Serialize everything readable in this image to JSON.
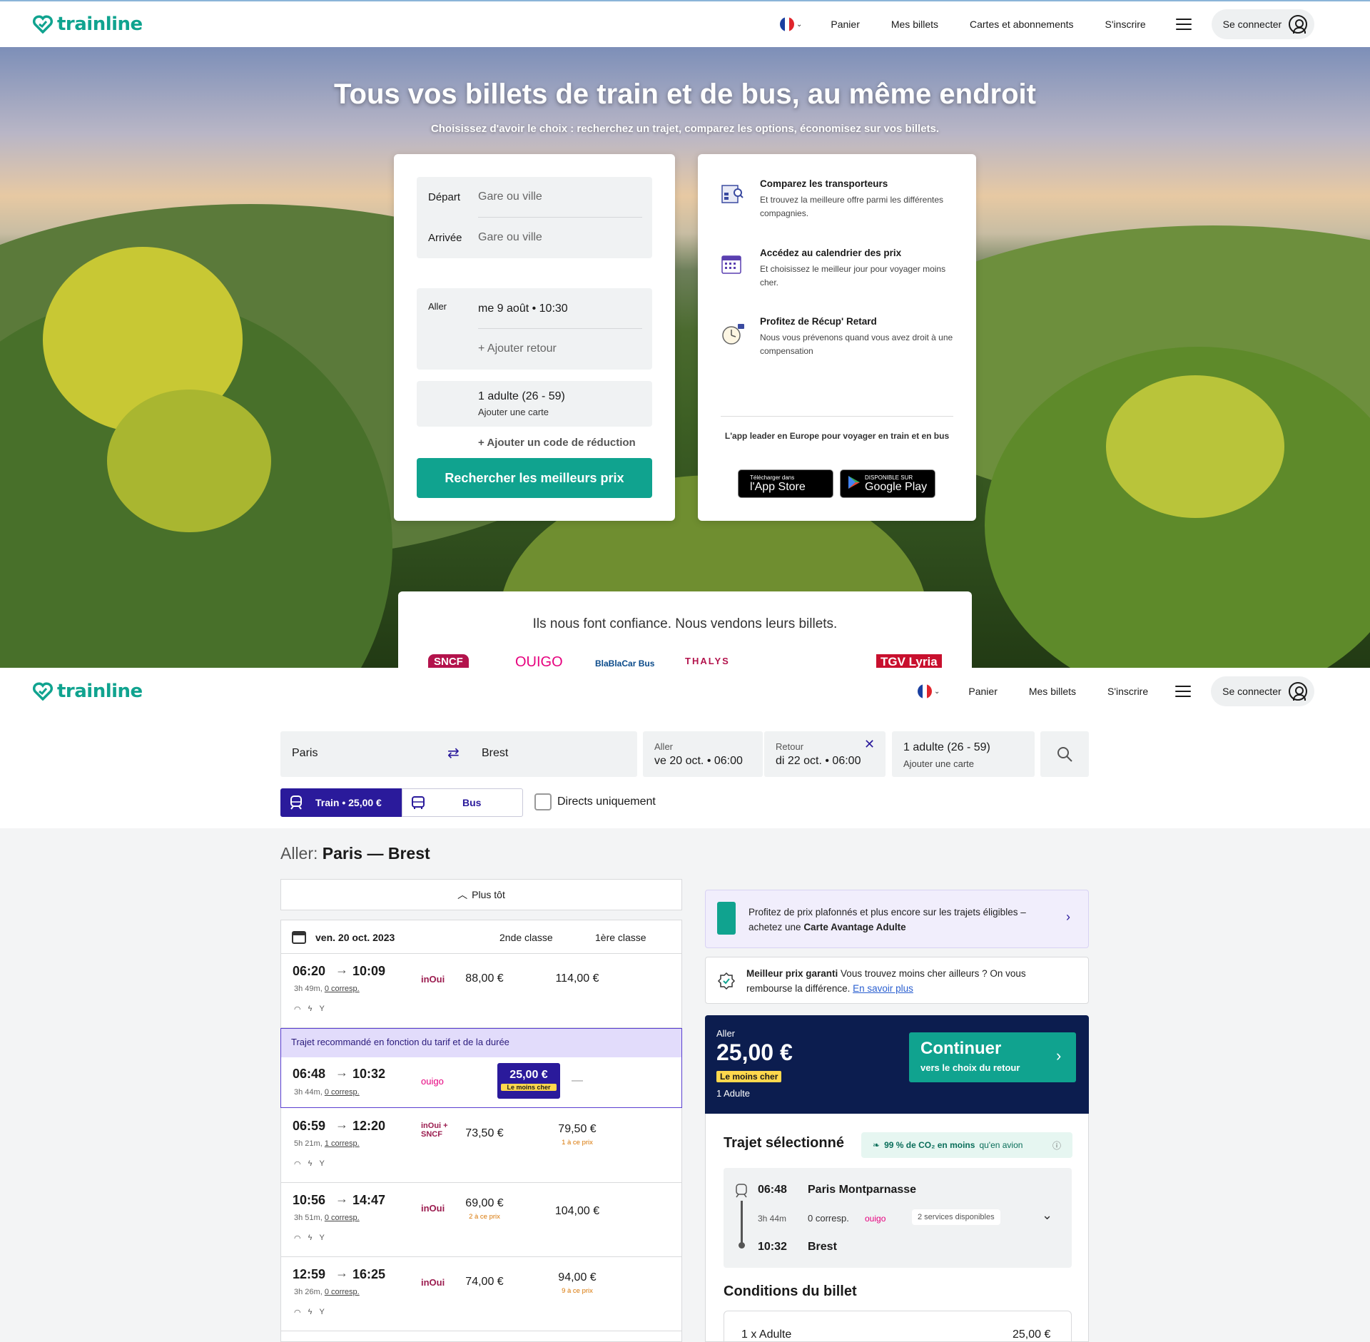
{
  "header": {
    "brand": "trainline",
    "nav": [
      "Panier",
      "Mes billets",
      "Cartes et abonnements",
      "S'inscrire"
    ],
    "login": "Se connecter"
  },
  "hero": {
    "title": "Tous vos billets de train et de bus, au même endroit",
    "subtitle": "Choisissez d'avoir le choix : recherchez un trajet, comparez les options, économisez sur vos billets.",
    "form": {
      "depart_label": "Départ",
      "depart_placeholder": "Gare ou ville",
      "arrivee_label": "Arrivée",
      "arrivee_placeholder": "Gare ou ville",
      "aller_label": "Aller",
      "aller_value": "me 9 août • 10:30",
      "add_return": "+ Ajouter retour",
      "passengers": "1 adulte (26 - 59)",
      "add_card": "Ajouter une carte",
      "promo": "+ Ajouter un code de réduction",
      "submit": "Rechercher les meilleurs prix"
    },
    "features": [
      {
        "title": "Comparez les transporteurs",
        "text": "Et trouvez la meilleure offre parmi les différentes compagnies.",
        "icon": "compare-icon"
      },
      {
        "title": "Accédez au calendrier des prix",
        "text": "Et choisissez le meilleur jour pour voyager moins cher.",
        "icon": "calendar-icon"
      },
      {
        "title": "Profitez de Récup' Retard",
        "text": "Nous vous prévenons quand vous avez droit à une compensation",
        "icon": "clock-icon"
      }
    ],
    "app_promo": "L'app leader en Europe pour voyager en train et en bus",
    "appstore_small": "Télécharger dans",
    "appstore_big": "l'App Store",
    "googleplay_small": "DISPONIBLE SUR",
    "googleplay_big": "Google Play",
    "trust_title": "Ils nous font confiance. Nous vendons leurs billets.",
    "brands": [
      "SNCF",
      "OUIGO",
      "BlaBlaCar Bus",
      "THALYS",
      "",
      "TGV Lyria"
    ]
  },
  "results_page": {
    "header": {
      "nav": [
        "Panier",
        "Mes billets",
        "S'inscrire"
      ],
      "login": "Se connecter"
    },
    "search": {
      "from": "Paris",
      "to": "Brest",
      "aller_label": "Aller",
      "aller_value": "ve 20 oct. • 06:00",
      "retour_label": "Retour",
      "retour_value": "di 22 oct. • 06:00",
      "passengers": "1 adulte (26 - 59)",
      "add_card": "Ajouter une carte"
    },
    "tabs": {
      "train": "Train • 25,00 €",
      "bus": "Bus"
    },
    "direct_only": "Directs uniquement",
    "heading_prefix": "Aller: ",
    "heading_route": "Paris — Brest",
    "earlier": "Plus tôt",
    "list_header": {
      "date": "ven. 20 oct. 2023",
      "col2": "2nde classe",
      "col1": "1ère classe"
    },
    "recommended_label": "Trajet recommandé en fonction du tarif et de la durée",
    "rows": [
      {
        "dep": "06:20",
        "arr": "10:09",
        "duration": "3h 49m,",
        "corresp": "0 corresp.",
        "operator": "inOui",
        "p2": "88,00 €",
        "p2sub": "",
        "p1": "114,00 €",
        "p1sub": ""
      },
      {
        "dep": "06:48",
        "arr": "10:32",
        "duration": "3h 44m,",
        "corresp": "0 corresp.",
        "operator": "ouigo",
        "p2": "25,00 €",
        "p2sub": "Le moins cher",
        "p1": "—",
        "p1sub": ""
      },
      {
        "dep": "06:59",
        "arr": "12:20",
        "duration": "5h 21m,",
        "corresp": "1 corresp.",
        "operator": "inOui + SNCF",
        "p2": "73,50 €",
        "p2sub": "",
        "p1": "79,50 €",
        "p1sub": "1 à ce prix"
      },
      {
        "dep": "10:56",
        "arr": "14:47",
        "duration": "3h 51m,",
        "corresp": "0 corresp.",
        "operator": "inOui",
        "p2": "69,00 €",
        "p2sub": "2 à ce prix",
        "p1": "104,00 €",
        "p1sub": ""
      },
      {
        "dep": "12:59",
        "arr": "16:25",
        "duration": "3h 26m,",
        "corresp": "0 corresp.",
        "operator": "inOui",
        "p2": "74,00 €",
        "p2sub": "",
        "p1": "94,00 €",
        "p1sub": "9 à ce prix"
      }
    ],
    "promo_card": {
      "text": "Profitez de prix plafonnés et plus encore sur les trajets éligibles – achetez une ",
      "bold": "Carte Avantage Adulte"
    },
    "best_price": {
      "bold": "Meilleur prix garanti",
      "text": " Vous trouvez moins cher ailleurs ? On vous rembourse la différence. ",
      "link": "En savoir plus"
    },
    "summary": {
      "label": "Aller",
      "price": "25,00 €",
      "badge": "Le moins cher",
      "pax": "1 Adulte",
      "cta": "Continuer",
      "cta_sub": "vers le choix du retour"
    },
    "selected": {
      "title": "Trajet sélectionné",
      "co2": "99 % de CO₂ en moins",
      "co2_suffix": " qu'en avion",
      "dep_time": "06:48",
      "dep_station": "Paris Montparnasse",
      "duration": "3h 44m",
      "corresp": "0 corresp.",
      "operator": "ouigo",
      "services": "2 services disponibles",
      "arr_time": "10:32",
      "arr_station": "Brest"
    },
    "conditions": {
      "title": "Conditions du billet",
      "line": "1 x Adulte",
      "amount": "25,00 €"
    }
  },
  "colors": {
    "brand": "#10a38f",
    "accent": "#2a1a9b",
    "navy": "#0c1d4f",
    "highlight": "#ffd84d"
  }
}
